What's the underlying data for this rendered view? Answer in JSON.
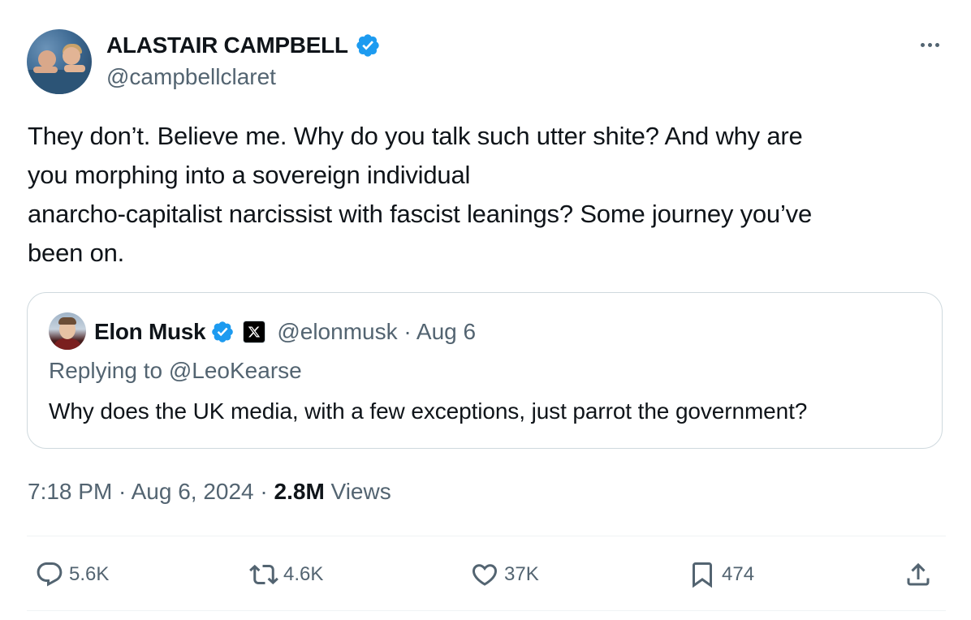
{
  "author": {
    "display_name": "ALASTAIR CAMPBELL",
    "handle": "@campbellclaret"
  },
  "tweet": {
    "lines": [
      "They don’t. Believe me. Why do you talk such utter shite? And why are",
      "you morphing into a sovereign individual",
      "anarcho-capitalist narcissist with fascist leanings? Some journey you’ve",
      "been on."
    ]
  },
  "quoted": {
    "display_name": "Elon Musk",
    "meta": "@elonmusk · Aug 6",
    "replying_to": "Replying to @LeoKearse",
    "text": "Why does the UK media, with a few exceptions, just parrot the government?"
  },
  "timestamp": {
    "time_date": "7:18 PM · Aug 6, 2024 · ",
    "views_count": "2.8M",
    "views_label": " Views"
  },
  "actions": {
    "replies": "5.6K",
    "reposts": "4.6K",
    "likes": "37K",
    "bookmarks": "474"
  },
  "colors": {
    "verified": "#1d9bf0",
    "secondary_text": "#536471",
    "primary_text": "#0f1419",
    "border": "#cfd9de"
  },
  "icons": [
    "verified-badge-icon",
    "more-icon",
    "x-logo-icon",
    "reply-icon",
    "repost-icon",
    "like-icon",
    "bookmark-icon",
    "share-icon"
  ]
}
